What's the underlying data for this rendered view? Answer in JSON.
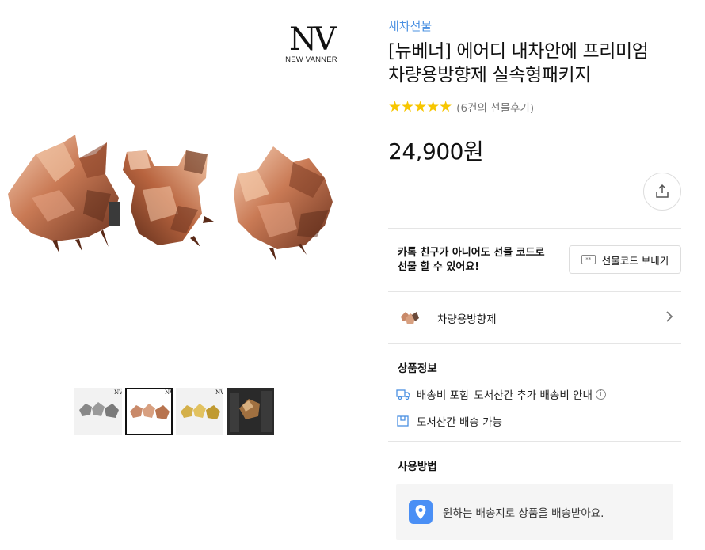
{
  "brand": {
    "logo_mark": "NV",
    "logo_name": "NEW VANNER"
  },
  "gallery": {
    "thumbnails": [
      {
        "name": "thumb-silver",
        "color": "#8c8c8c"
      },
      {
        "name": "thumb-rosegold",
        "color": "#c98a6a",
        "active": true
      },
      {
        "name": "thumb-gold",
        "color": "#d4b04a"
      },
      {
        "name": "thumb-installed",
        "color": "#7a5a3a"
      }
    ]
  },
  "product": {
    "category": "새차선물",
    "title_line1": "[뉴베너] 에어디 내차안에 프리미엄",
    "title_line2": "차량용방향제 실속형패키지",
    "stars": "★★★★★",
    "review_count": "(6건의 선물후기)",
    "rating": 5,
    "price": "24,900원"
  },
  "gift": {
    "line1": "카톡 친구가 아니어도 선물 코드로",
    "line2": "선물 할 수 있어요!",
    "button_label": "선물코드 보내기",
    "button_icon_text": "**"
  },
  "option": {
    "label": "차량용방향제"
  },
  "product_info": {
    "title": "상품정보",
    "shipping_text": "배송비 포함",
    "shipping_extra": "도서산간 추가 배송비 안내",
    "remote_text": "도서산간 배송 가능"
  },
  "usage": {
    "title": "사용방법",
    "text": "원하는 배송지로 상품을 배송받아요."
  },
  "colors": {
    "accent": "#4a90e2",
    "star": "#f7c600",
    "pin": "#4a8ff5"
  }
}
